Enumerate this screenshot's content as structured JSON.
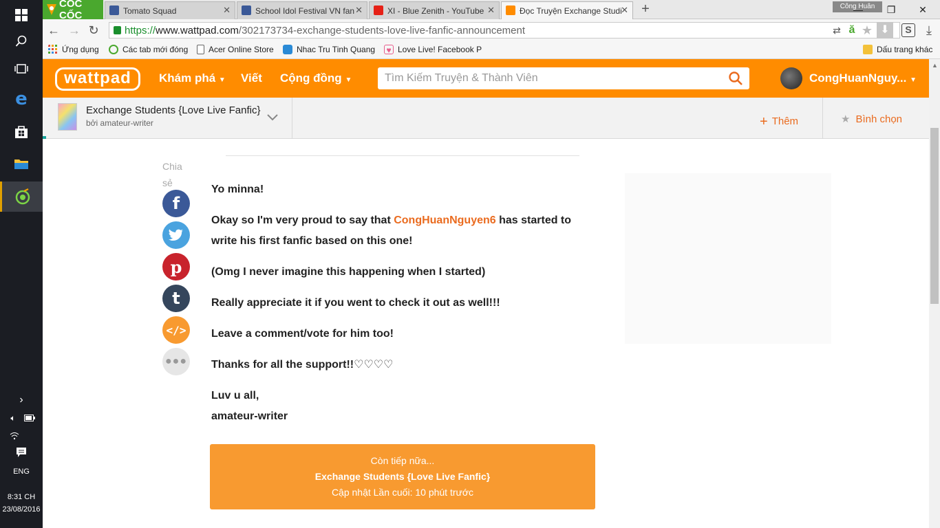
{
  "taskbar": {
    "lang": "ENG",
    "time": "8:31 CH",
    "date": "23/08/2016",
    "icons": [
      "windows-icon",
      "search-icon",
      "task-view-icon",
      "edge-icon",
      "store-icon",
      "file-explorer-icon",
      "coccoc-taskbar-icon",
      "chevron-right-icon",
      "volume-icon",
      "battery-icon",
      "wifi-icon",
      "notification-icon"
    ]
  },
  "browser": {
    "brand": "CỐC CỐC",
    "user_badge": "Công Huân",
    "tabs": [
      {
        "label": "Tomato Squad",
        "favicon": "facebook-icon",
        "color": "#3b5998"
      },
      {
        "label": "School Idol Festival VN fan",
        "favicon": "facebook-icon",
        "color": "#3b5998"
      },
      {
        "label": "XI - Blue Zenith - YouTube",
        "favicon": "youtube-icon",
        "color": "#e62117"
      },
      {
        "label": "Đọc Truyện Exchange Studi",
        "favicon": "wattpad-icon",
        "color": "#ff8c00"
      }
    ],
    "url_scheme": "https://",
    "url_host": "www.wattpad.com",
    "url_path": "/302173734-exchange-students-love-live-fanfic-announcement",
    "bookmarks": [
      {
        "label": "Ứng dụng",
        "icon": "apps-grid-icon"
      },
      {
        "label": "Các tab mới đóng",
        "icon": "recent-tabs-icon"
      },
      {
        "label": "Acer Online Store",
        "icon": "page-icon"
      },
      {
        "label": "Nhac Tru Tinh Quang",
        "icon": "music-icon"
      },
      {
        "label": "Love Live! Facebook P",
        "icon": "heart-icon"
      }
    ],
    "other_bookmarks": "Dấu trang khác"
  },
  "wattpad": {
    "logo": "wattpad",
    "nav": {
      "discover": "Khám phá",
      "write": "Viết",
      "community": "Cộng đồng"
    },
    "search_placeholder": "Tìm Kiếm Truyện & Thành Viên",
    "username": "CongHuanNguy...",
    "accent": "#ff8c00"
  },
  "story": {
    "title": "Exchange Students {Love Live Fanfic}",
    "author": "bởi amateur-writer",
    "add_label": "Thêm",
    "vote_label": "Bình chọn"
  },
  "share": {
    "label": "Chia sẻ",
    "buttons": [
      {
        "name": "facebook-share-button",
        "icon": "facebook-icon",
        "color": "#3b5998"
      },
      {
        "name": "twitter-share-button",
        "icon": "twitter-icon",
        "color": "#4aa3df"
      },
      {
        "name": "pinterest-share-button",
        "icon": "pinterest-icon",
        "color": "#c8232c"
      },
      {
        "name": "tumblr-share-button",
        "icon": "tumblr-icon",
        "color": "#35465c"
      },
      {
        "name": "embed-share-button",
        "icon": "embed-icon",
        "color": "#f89a30"
      },
      {
        "name": "more-share-button",
        "icon": "more-icon",
        "color": "#e6e6e6"
      }
    ]
  },
  "body": {
    "p1": "Yo minna!",
    "p2_before": "Okay so I'm very proud to say that ",
    "p2_mention": "CongHuanNguyen6",
    "p2_after": " has started to write his first fanfic based on this one!",
    "p3": "(Omg I never imagine this happening when I started)",
    "p4": "Really appreciate it if you went to check it out as well!!!",
    "p5": "Leave a comment/vote for him too!",
    "p6": "Thanks for all the support!!♡♡♡♡",
    "p7a": "Luv u all,",
    "p7b": "amateur-writer"
  },
  "next": {
    "line1": "Còn tiếp nữa...",
    "line2": "Exchange Students {Love Live Fanfic}",
    "line3": "Cập nhật Lần cuối: 10 phút trước"
  }
}
